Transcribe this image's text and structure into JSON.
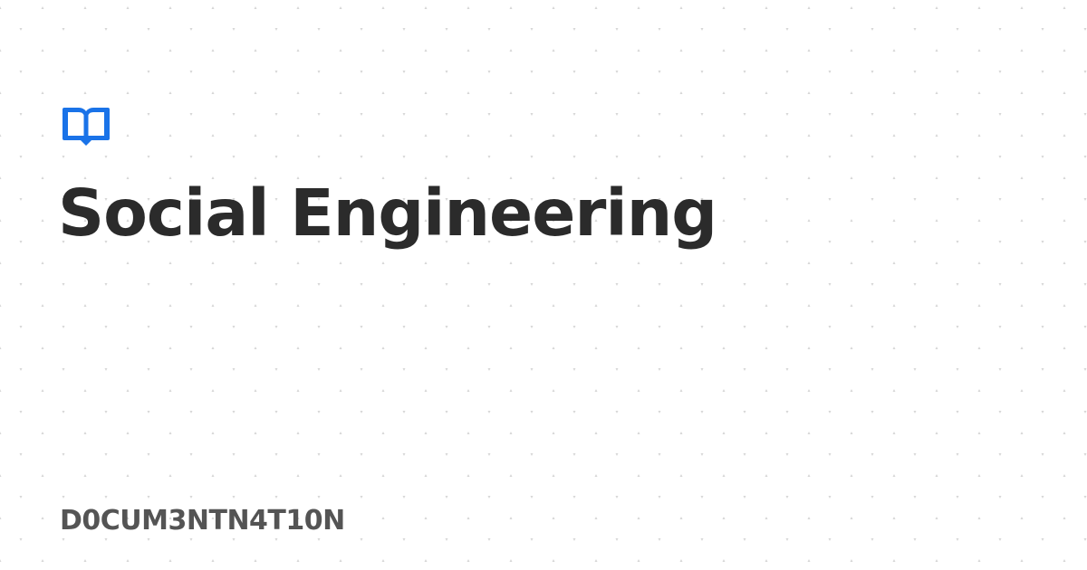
{
  "page": {
    "title": "Social Engineering",
    "site_name": "D0CUM3NTN4T10N"
  },
  "icons": {
    "logo": "open-book-icon",
    "background": "dot-pattern"
  },
  "colors": {
    "background": "#ffffff",
    "accent": "#1a73e8",
    "title": "#2b2b2b",
    "site_name": "#545454",
    "pattern": "#d6d6d6"
  }
}
